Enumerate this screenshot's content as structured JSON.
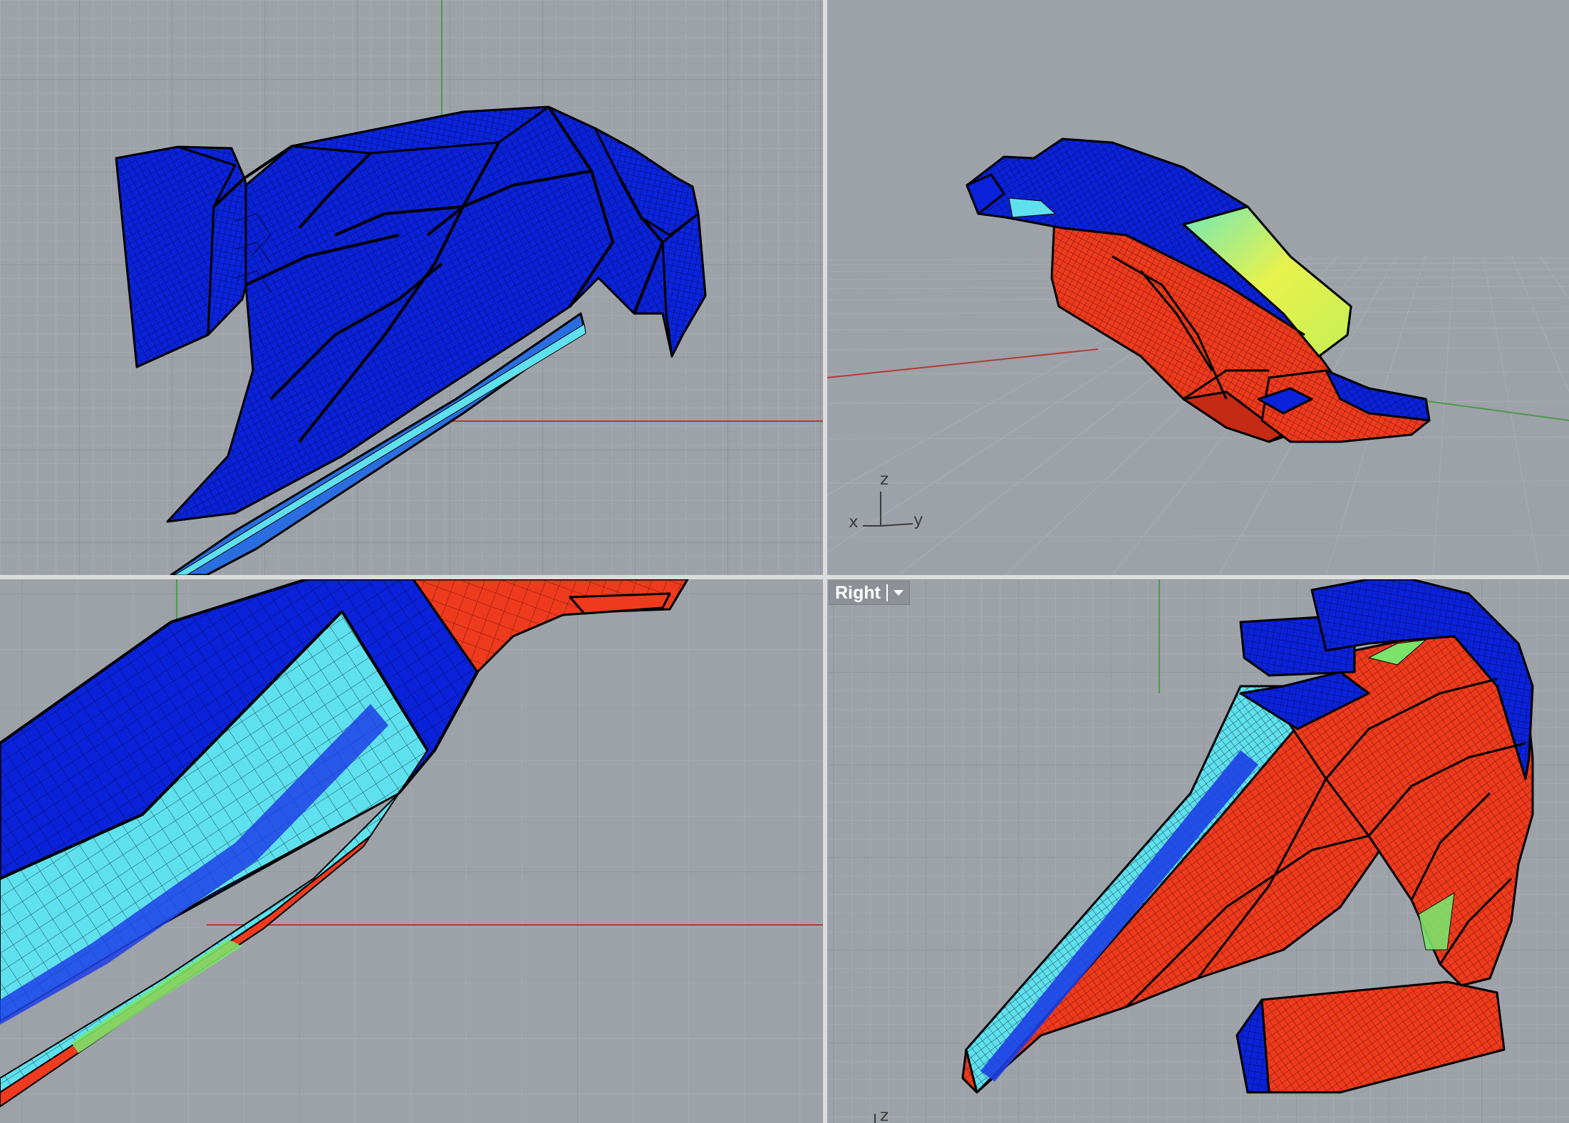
{
  "viewports": [
    {
      "name": "top-left",
      "title": ""
    },
    {
      "name": "top-right",
      "title": "",
      "axis_labels": {
        "z": "z",
        "x": "x",
        "y": "y"
      }
    },
    {
      "name": "bottom-left",
      "title": ""
    },
    {
      "name": "bottom-right",
      "title": "Right",
      "axis_labels": {
        "z": "z"
      }
    }
  ],
  "icons": {
    "viewport_menu": "chevron-down-icon",
    "gizmo": "axis-gizmo-icon"
  },
  "colors": {
    "viewport_bg": "#9da1a8",
    "grid_minor": "#a7abb1",
    "grid_major": "#8d9198",
    "x_axis": "#b23b33",
    "y_axis": "#4a9a4a",
    "mesh_low": "#0a22d9",
    "mesh_mid_low": "#5fe0ee",
    "mesh_mid_high": "#d7f04a",
    "mesh_high": "#ee3a1d",
    "edge": "#0b0b0b"
  }
}
